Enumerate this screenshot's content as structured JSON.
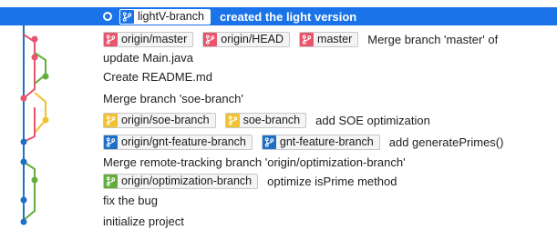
{
  "colors": {
    "selected_bg": "#1a73e8",
    "lane_blue": "#1f6fc5",
    "lane_red": "#e8546c",
    "lane_green": "#62ad3c",
    "lane_yellow": "#f2c12e"
  },
  "commits": [
    {
      "message": "created the light version",
      "selected": true,
      "refs": [
        {
          "label": "lightV-branch",
          "color": "#1a73e8",
          "icon": "branch-icon"
        }
      ]
    },
    {
      "message": "Merge branch 'master' of",
      "refs": [
        {
          "label": "origin/master",
          "color": "#e8546c",
          "icon": "branch-icon"
        },
        {
          "label": "origin/HEAD",
          "color": "#e8546c",
          "icon": "branch-icon"
        },
        {
          "label": "master",
          "color": "#e8546c",
          "icon": "branch-icon"
        }
      ]
    },
    {
      "message": "update Main.java",
      "refs": []
    },
    {
      "message": "Create README.md",
      "refs": []
    },
    {
      "message": "Merge branch 'soe-branch'",
      "refs": []
    },
    {
      "message": "add SOE optimization",
      "refs": [
        {
          "label": "origin/soe-branch",
          "color": "#f2c12e",
          "icon": "branch-icon"
        },
        {
          "label": "soe-branch",
          "color": "#f2c12e",
          "icon": "branch-icon"
        }
      ]
    },
    {
      "message": "add generatePrimes()",
      "refs": [
        {
          "label": "origin/gnt-feature-branch",
          "color": "#1f6fc5",
          "icon": "branch-icon"
        },
        {
          "label": "gnt-feature-branch",
          "color": "#1f6fc5",
          "icon": "branch-icon"
        }
      ]
    },
    {
      "message": "Merge remote-tracking branch 'origin/optimization-branch'",
      "refs": []
    },
    {
      "message": "optimize isPrime method",
      "refs": [
        {
          "label": "origin/optimization-branch",
          "color": "#62ad3c",
          "icon": "branch-icon"
        }
      ]
    },
    {
      "message": "fix the bug",
      "refs": []
    },
    {
      "message": "initialize project",
      "refs": []
    }
  ]
}
